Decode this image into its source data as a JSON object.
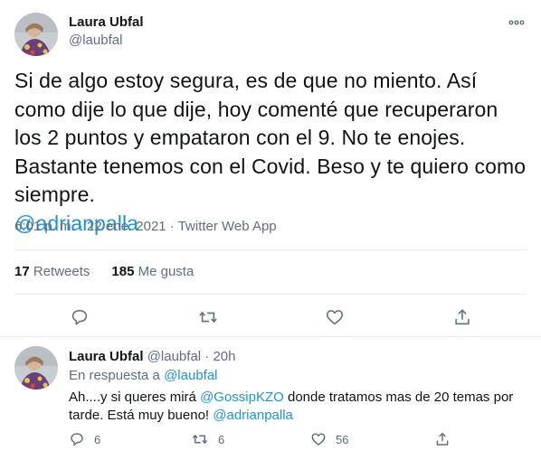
{
  "main_tweet": {
    "author_name": "Laura Ubfal",
    "author_handle": "@laubfal",
    "text_line1": "Si de algo estoy segura, es de que no miento. Así como dije lo que dije, hoy comenté que recuperaron los 2 puntos y empataron con el 9. No te enojes. Bastante tenemos con el Covid. Beso y te quiero como siempre.",
    "mention": "@adrianpalla",
    "time": "6:01 p. m.",
    "separator": " · ",
    "date": "22 ene. 2021",
    "source": "Twitter Web App",
    "retweets_count": "17",
    "retweets_label": "Retweets",
    "likes_count": "185",
    "likes_label": "Me gusta"
  },
  "reply_tweet": {
    "author_name": "Laura Ubfal",
    "author_handle": "@laubfal",
    "separator": " · ",
    "time_ago": "20h",
    "replying_prefix": "En respuesta a ",
    "replying_to": "@laubfal",
    "text_part1": "Ah....y si queres mirá ",
    "mention1": "@GossipKZO",
    "text_part2": " donde tratamos mas de 20 temas por tarde. Está muy bueno! ",
    "mention2": "@adrianpalla",
    "reply_count": "6",
    "retweet_count": "6",
    "like_count": "56"
  },
  "colors": {
    "text": "#0f1419",
    "secondary": "#5b7083",
    "link": "#1b95e0",
    "divider": "#e6ecf0"
  },
  "icons": [
    "more-icon",
    "reply-icon",
    "retweet-icon",
    "like-icon",
    "share-icon"
  ]
}
